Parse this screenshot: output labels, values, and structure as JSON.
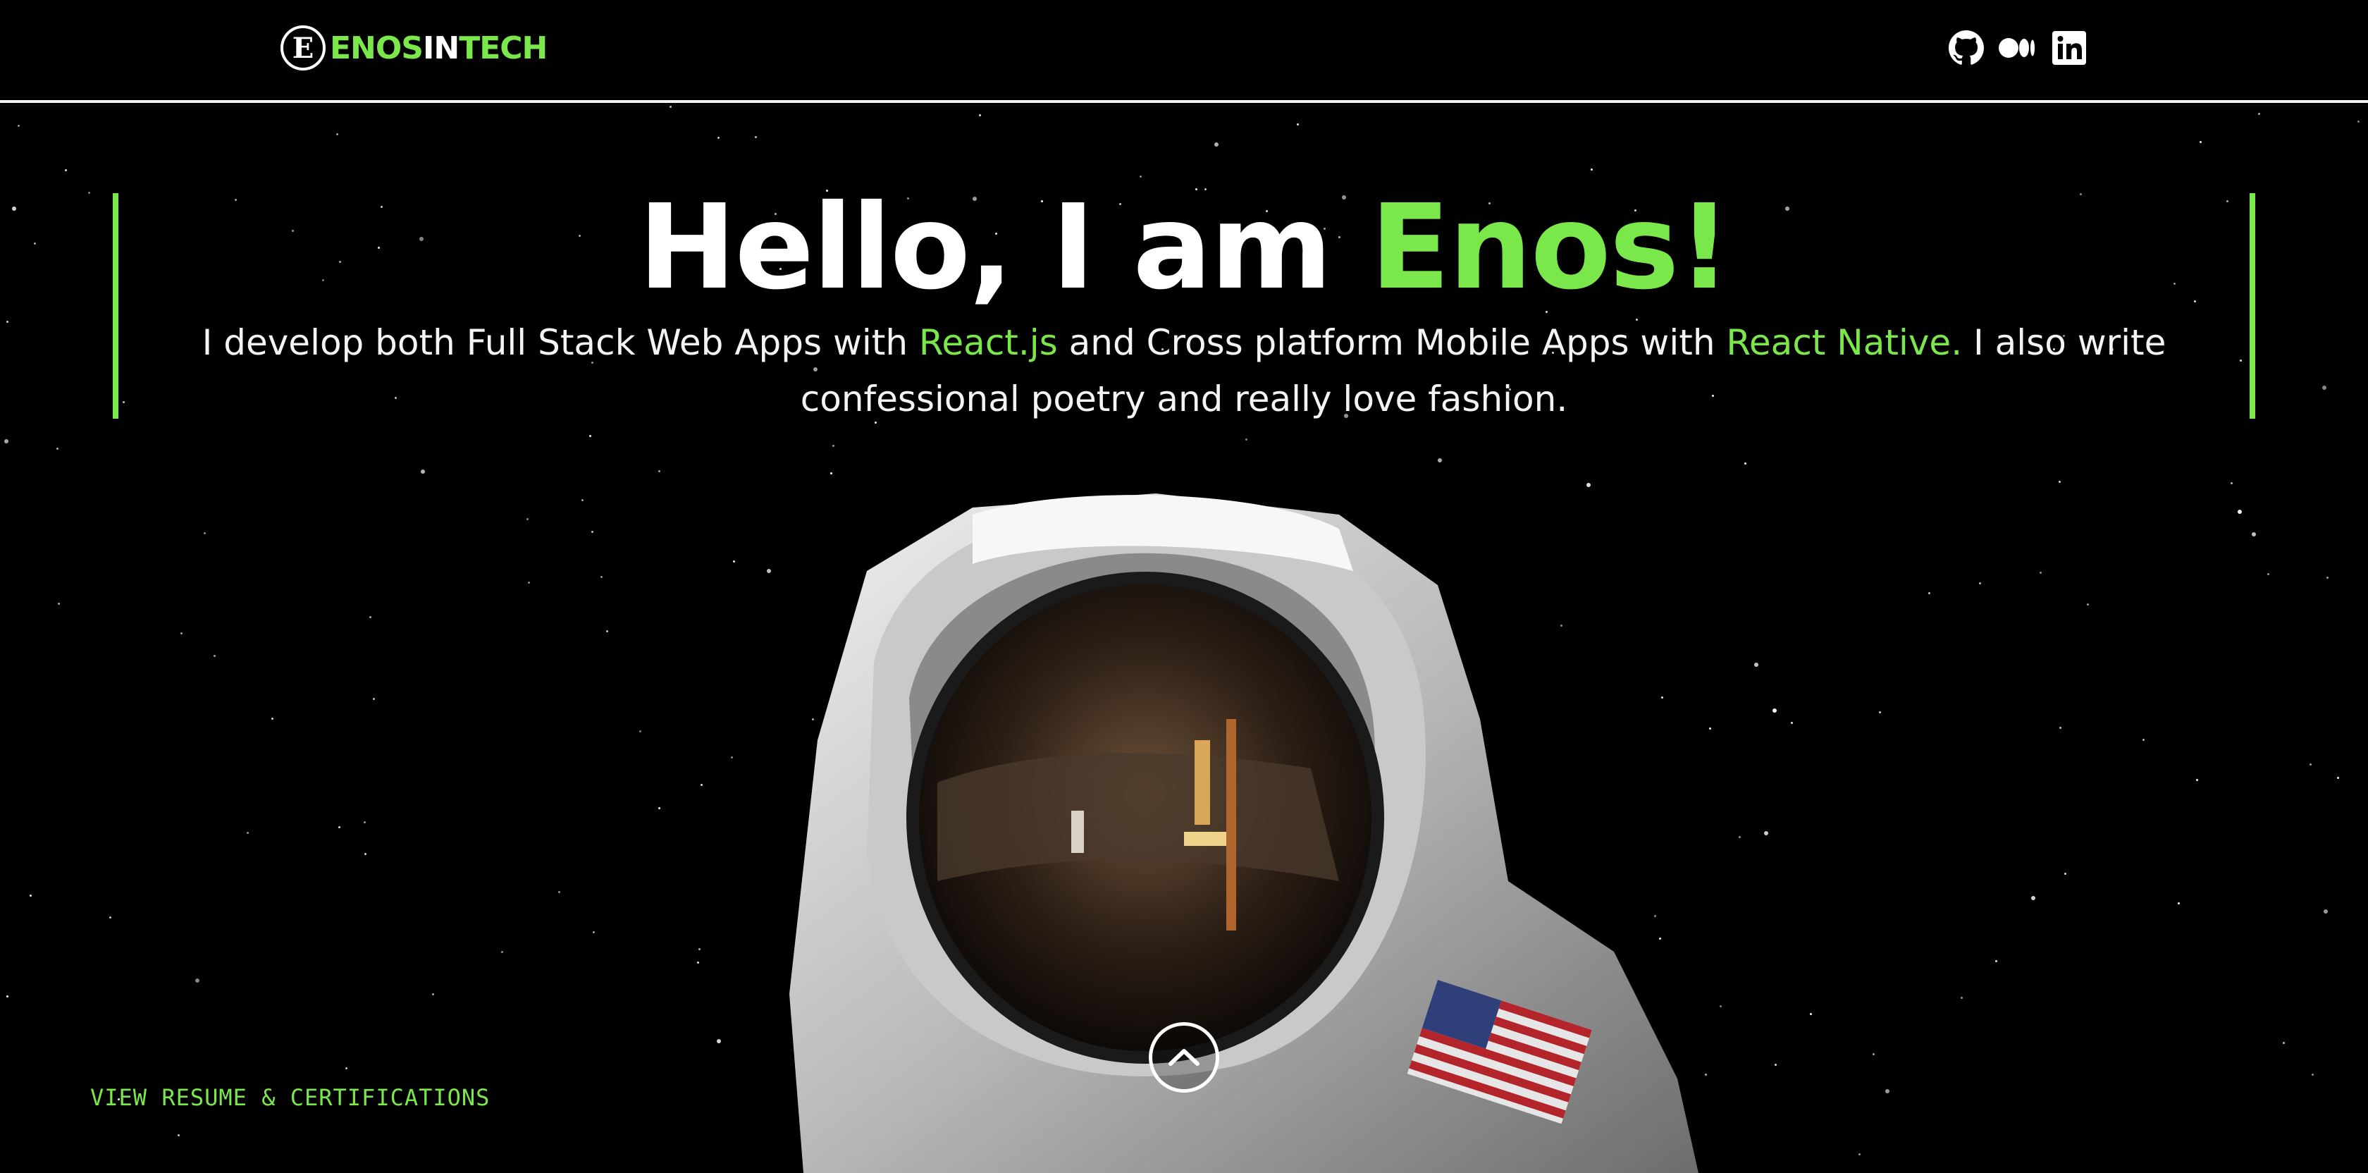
{
  "header": {
    "logo": {
      "mark_letter": "E",
      "text_part1": "ENOS",
      "text_part2": "IN",
      "text_part3": "TECH"
    },
    "social": [
      {
        "name": "github-icon"
      },
      {
        "name": "medium-icon"
      },
      {
        "name": "linkedin-icon"
      }
    ]
  },
  "hero": {
    "title_prefix": "Hello, I am ",
    "title_name": "Enos!",
    "intro": {
      "part1": "I develop both Full Stack Web Apps with ",
      "highlight1": "React.js",
      "part2": " and Cross platform Mobile Apps with ",
      "highlight2": "React Native.",
      "part3": " I also write confessional poetry and really love fashion."
    }
  },
  "footer": {
    "resume_link": "VIEW RESUME & CERTIFICATIONS",
    "scroll_button": "chevron-up-icon"
  },
  "colors": {
    "accent": "#7ae84a",
    "background": "#000000",
    "text": "#ffffff"
  }
}
